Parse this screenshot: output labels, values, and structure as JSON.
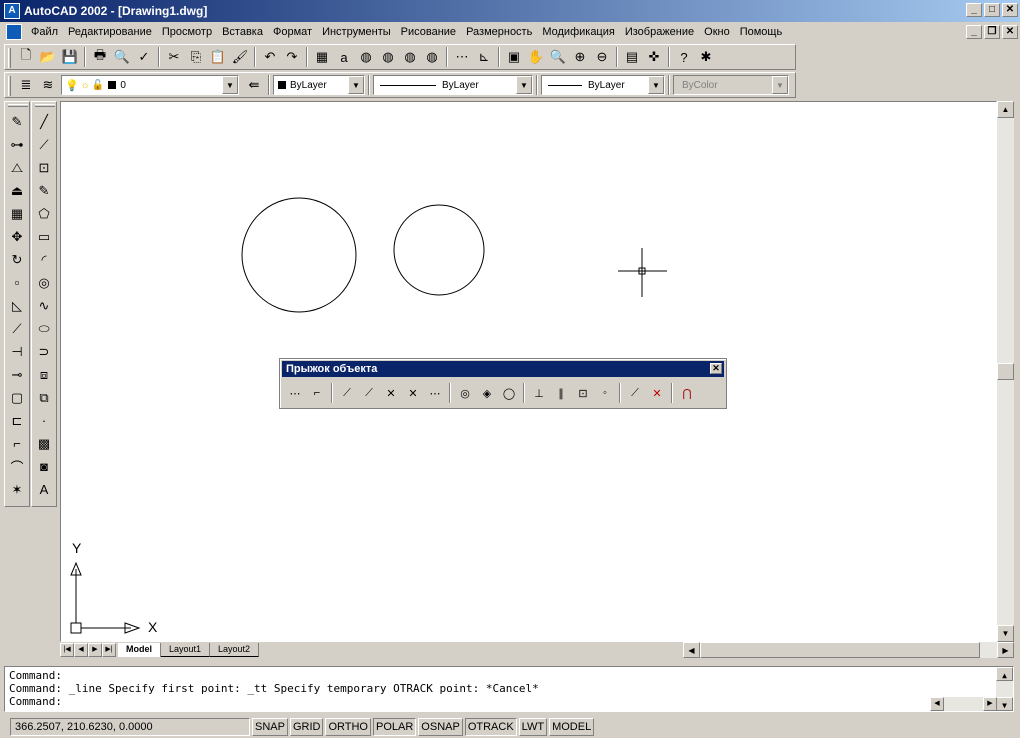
{
  "window": {
    "title": "AutoCAD 2002 - [Drawing1.dwg]",
    "min": "_",
    "max": "□",
    "close": "✕",
    "mdi_min": "_",
    "mdi_restore": "❐",
    "mdi_close": "✕"
  },
  "menu": [
    "Файл",
    "Редактирование",
    "Просмотр",
    "Вставка",
    "Формат",
    "Инструменты",
    "Рисование",
    "Размерность",
    "Модификация",
    "Изображение",
    "Окно",
    "Помощь"
  ],
  "standard_toolbar": {
    "icons": [
      "new-icon",
      "open-icon",
      "save-icon",
      "print-icon",
      "print-preview-icon",
      "spell-check-icon",
      "cut-icon",
      "copy-icon",
      "paste-icon",
      "match-properties-icon",
      "undo-icon",
      "redo-icon",
      "design-center-icon",
      "autodesk-point-a-icon",
      "web-icon-1",
      "web-icon-2",
      "web-icon-3",
      "web-icon-4",
      "tracking-icon",
      "ucs-icon",
      "named-views-icon",
      "pan-realtime-icon",
      "zoom-realtime-icon",
      "zoom-window-icon",
      "zoom-previous-icon",
      "properties-icon",
      "design-tool-icon",
      "help-icon",
      "today-icon"
    ],
    "glyphs": [
      "🗋",
      "📂",
      "💾",
      "🖶",
      "🔍",
      "✓",
      "✂",
      "⎘",
      "📋",
      "🖌",
      "↶",
      "↷",
      "▦",
      "a",
      "◍",
      "◍",
      "◍",
      "◍",
      "⋯",
      "⊾",
      "▣",
      "✋",
      "🔍",
      "⊕",
      "⊖",
      "▤",
      "✜",
      "?",
      "✱"
    ]
  },
  "layer_toolbar": {
    "layer_name": "0",
    "color": "ByLayer",
    "linetype": "ByLayer",
    "lineweight": "ByLayer",
    "plotstyle": "ByColor"
  },
  "draw_toolbar_glyphs": [
    "╱",
    "⟋",
    "⊡",
    "✎",
    "⬠",
    "▭",
    "◜",
    "◎",
    "∿",
    "⬭",
    "⊃",
    "⧈",
    "⧉",
    "·",
    "▩",
    "◙",
    "A"
  ],
  "draw_toolbar_icons": [
    "line-icon",
    "construction-line-icon",
    "multiline-icon",
    "polyline-icon",
    "polygon-icon",
    "rectangle-icon",
    "arc-icon",
    "circle-icon",
    "spline-icon",
    "ellipse-icon",
    "revision-cloud-icon",
    "insert-block-icon",
    "make-block-icon",
    "point-icon",
    "hatch-icon",
    "region-icon",
    "multiline-text-icon"
  ],
  "modify_toolbar_glyphs": [
    "✎",
    "⊶",
    "⧍",
    "⏏",
    "▦",
    "✥",
    "↻",
    "▫",
    "◺",
    "⟋",
    "⊣",
    "⊸",
    "▢",
    "⊏",
    "⌐",
    "⌒",
    "✶"
  ],
  "modify_toolbar_icons": [
    "erase-icon",
    "copy-object-icon",
    "mirror-icon",
    "offset-icon",
    "array-icon",
    "move-icon",
    "rotate-icon",
    "scale-icon",
    "stretch-icon",
    "lengthen-icon",
    "trim-icon",
    "extend-icon",
    "break-icon",
    "break-at-point-icon",
    "chamfer-icon",
    "fillet-icon",
    "explode-icon"
  ],
  "osnap_toolbar": {
    "title": "Прыжок объекта",
    "close": "✕",
    "icons": [
      "temporary-track-point-icon",
      "snap-from-icon",
      "snap-endpoint-icon",
      "snap-midpoint-icon",
      "snap-intersection-icon",
      "snap-apparent-intersection-icon",
      "snap-extension-icon",
      "snap-center-icon",
      "snap-quadrant-icon",
      "snap-tangent-icon",
      "snap-perpendicular-icon",
      "snap-parallel-icon",
      "snap-insert-icon",
      "snap-node-icon",
      "snap-nearest-icon",
      "snap-none-icon",
      "osnap-settings-icon"
    ],
    "glyphs": [
      "⋯",
      "⌐",
      "⟋",
      "⟋",
      "✕",
      "✕",
      "⋯",
      "◎",
      "◈",
      "◯",
      "⊥",
      "∥",
      "⊡",
      "◦",
      "⟋",
      "✕",
      "⋂"
    ]
  },
  "ucs": {
    "y_label": "Y",
    "x_label": "X"
  },
  "tabs": [
    "Model",
    "Layout1",
    "Layout2"
  ],
  "nav_glyphs": [
    "|◀",
    "◀",
    "▶",
    "▶|"
  ],
  "command_lines": [
    "Command:",
    "Command: _line Specify first point: _tt Specify temporary OTRACK point: *Cancel*",
    "Command:"
  ],
  "status": {
    "coords": "366.2507, 210.6230, 0.0000",
    "toggles": [
      "SNAP",
      "GRID",
      "ORTHO",
      "POLAR",
      "OSNAP",
      "OTRACK",
      "LWT",
      "MODEL"
    ]
  }
}
